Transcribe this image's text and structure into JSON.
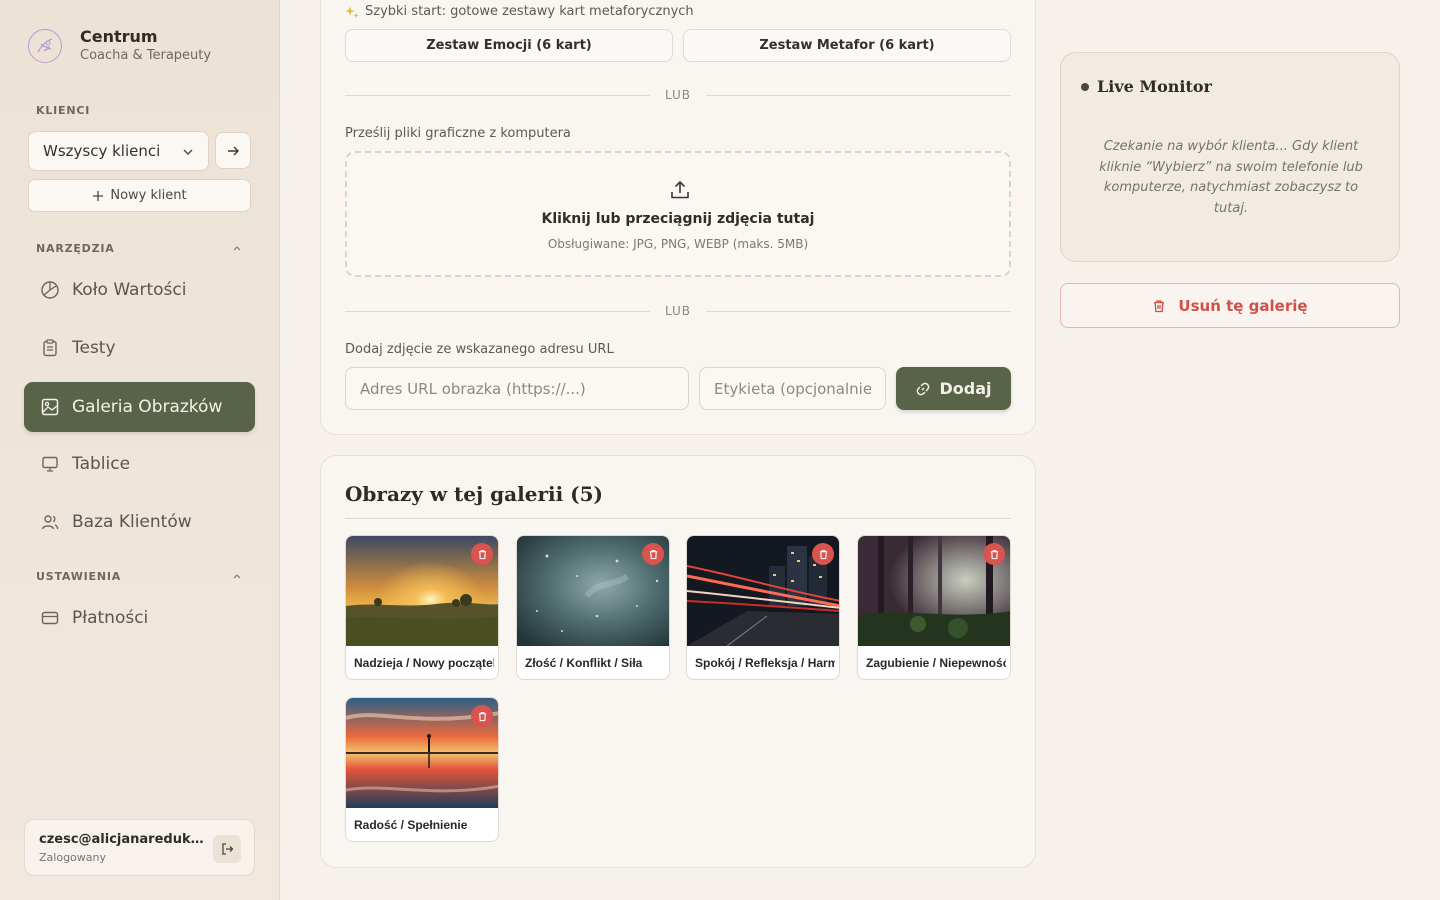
{
  "brand": {
    "name": "Centrum",
    "subtitle": "Coacha & Terapeuty"
  },
  "sidebar": {
    "clients_label": "KLIENCI",
    "client_select_value": "Wszyscy klienci",
    "new_client_label": "Nowy klient",
    "tools_label": "NARZĘDZIA",
    "settings_label": "USTAWIENIA",
    "items": [
      {
        "label": "Koło Wartości",
        "icon": "wheel-icon"
      },
      {
        "label": "Testy",
        "icon": "clipboard-icon"
      },
      {
        "label": "Galeria Obrazków",
        "icon": "image-icon",
        "active": true
      },
      {
        "label": "Tablice",
        "icon": "presentation-icon"
      },
      {
        "label": "Baza Klientów",
        "icon": "users-icon"
      },
      {
        "label": "Płatności",
        "icon": "credit-card-icon"
      }
    ],
    "user": {
      "email": "czesc@alicjanaredukcji...",
      "status": "Zalogowany"
    }
  },
  "upload": {
    "quickstart_label": "Szybki start: gotowe zestawy kart metaforycznych",
    "set_buttons": [
      "Zestaw Emocji (6 kart)",
      "Zestaw Metafor (6 kart)"
    ],
    "divider_text": "LUB",
    "file_label": "Prześlij pliki graficzne z komputera",
    "dropzone_title": "Kliknij lub przeciągnij zdjęcia tutaj",
    "dropzone_hint": "Obsługiwane: JPG, PNG, WEBP (maks. 5MB)",
    "url_label": "Dodaj zdjęcie ze wskazanego adresu URL",
    "url_placeholder": "Adres URL obrazka (https://...)",
    "tag_placeholder": "Etykieta (opcjonalnie)",
    "add_button": "Dodaj"
  },
  "gallery": {
    "title": "Obrazy w tej galerii (5)",
    "images": [
      {
        "label": "Nadzieja / Nowy początek"
      },
      {
        "label": "Złość / Konflikt / Siła"
      },
      {
        "label": "Spokój / Refleksja / Harmonia"
      },
      {
        "label": "Zagubienie / Niepewność"
      },
      {
        "label": "Radość / Spełnienie"
      }
    ]
  },
  "monitor": {
    "title": "Live Monitor",
    "text": "Czekanie na wybór klienta... Gdy klient kliknie “Wybierz” na swoim telefonie lub komputerze, natychmiast zobaczysz to tutaj."
  },
  "delete_gallery_label": "Usuń tę galerię",
  "colors": {
    "accent": "#586348",
    "danger": "#d9534f",
    "background": "#f6f1ea"
  }
}
